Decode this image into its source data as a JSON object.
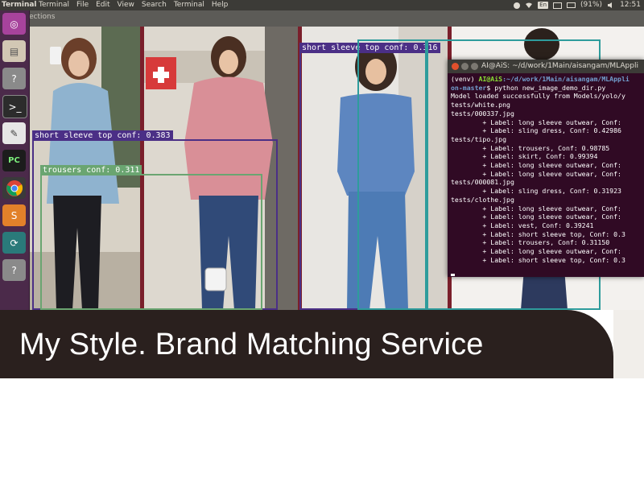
{
  "topbar": {
    "app_name": "Terminal",
    "menus": [
      "Terminal",
      "File",
      "Edit",
      "View",
      "Search",
      "Terminal",
      "Help"
    ],
    "keyboard_layout": "En",
    "battery": "(91%)",
    "time": "12:51"
  },
  "window": {
    "title_fragment": "ections"
  },
  "detections": [
    {
      "label": "short sleeve top conf: 0.383",
      "color": "#4b2f86"
    },
    {
      "label": "trousers conf: 0.311",
      "color": "#6aa571"
    },
    {
      "label": "short sleeve top conf: 0.316",
      "color": "#4b2f86"
    }
  ],
  "terminal": {
    "title": "AI@AiS: ~/d/work/1Main/aisangam/MLAppli",
    "venv": "(venv)",
    "prompt_user": "AI@AiS",
    "prompt_path": ":~/d/work/1Main/aisangam/MLAppli",
    "prompt_path2": "on-master",
    "command": "$ python new_image_demo_dir.py",
    "lines": [
      "Model loaded successfully from Models/yolo/y",
      "tests/white.png",
      "tests/000337.jpg",
      "        + Label: long sleeve outwear, Conf:",
      "        + Label: sling dress, Conf: 0.42986",
      "tests/tipo.jpg",
      "        + Label: trousers, Conf: 0.98785",
      "        + Label: skirt, Conf: 0.99394",
      "        + Label: long sleeve outwear, Conf:",
      "        + Label: long sleeve outwear, Conf:",
      "tests/000081.jpg",
      "        + Label: sling dress, Conf: 0.31923",
      "tests/clothe.jpg",
      "        + Label: long sleeve outwear, Conf:",
      "        + Label: long sleeve outwear, Conf:",
      "        + Label: vest, Conf: 0.39241",
      "        + Label: short sleeve top, Conf: 0.3",
      "        + Label: trousers, Conf: 0.31150",
      "        + Label: long sleeve outwear, Conf:",
      "        + Label: short sleeve top, Conf: 0.3"
    ]
  },
  "banner": {
    "text": "My Style. Brand Matching Service"
  }
}
